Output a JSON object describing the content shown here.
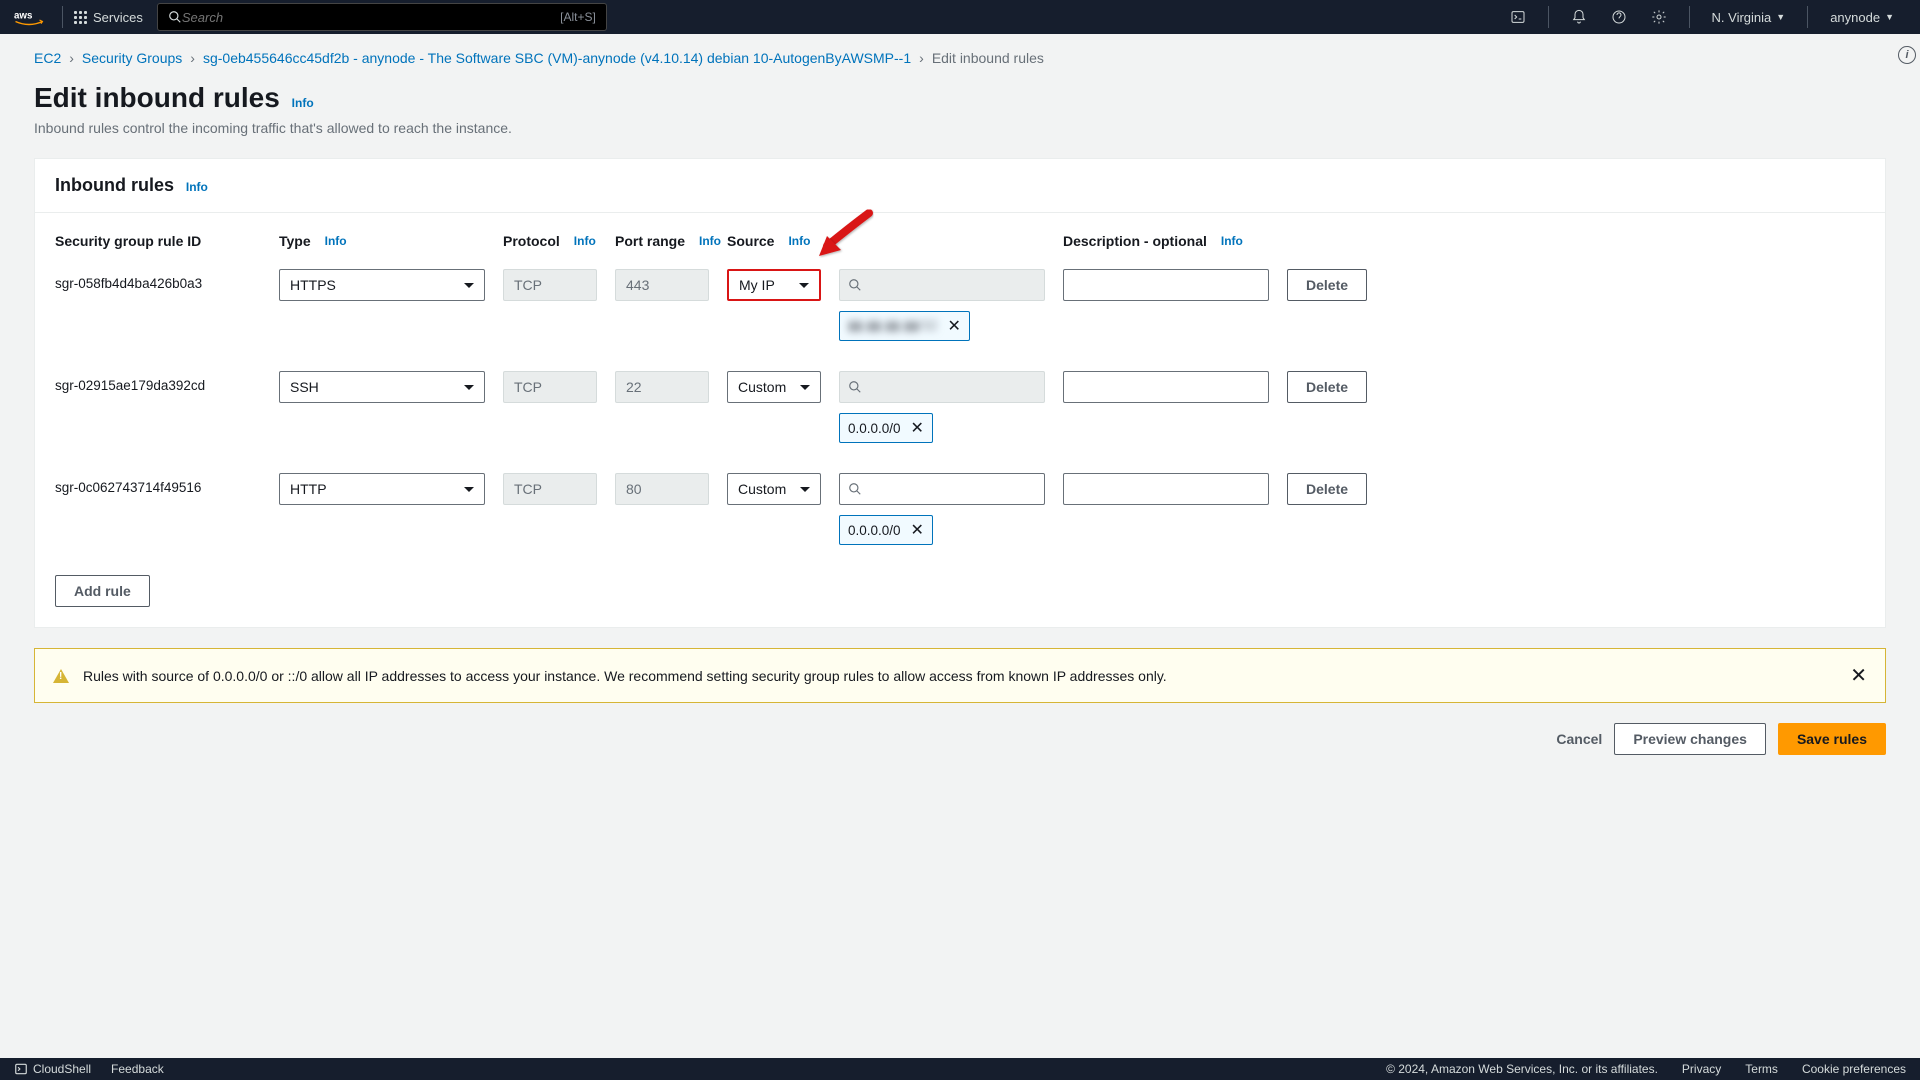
{
  "nav": {
    "services": "Services",
    "search_placeholder": "Search",
    "search_shortcut": "[Alt+S]",
    "region": "N. Virginia",
    "account": "anynode"
  },
  "breadcrumb": {
    "items": [
      "EC2",
      "Security Groups",
      "sg-0eb455646cc45df2b - anynode - The Software SBC (VM)-anynode (v4.10.14) debian 10-AutogenByAWSMP--1"
    ],
    "current": "Edit inbound rules"
  },
  "header": {
    "title": "Edit inbound rules",
    "info": "Info",
    "desc": "Inbound rules control the incoming traffic that's allowed to reach the instance."
  },
  "panel": {
    "title": "Inbound rules",
    "info": "Info"
  },
  "columns": {
    "id": "Security group rule ID",
    "type": "Type",
    "protocol": "Protocol",
    "port_range": "Port range",
    "source": "Source",
    "description": "Description - optional",
    "info": "Info",
    "delete": "Delete"
  },
  "rules": [
    {
      "id": "sgr-058fb4d4ba426b0a3",
      "type": "HTTPS",
      "protocol": "TCP",
      "port": "443",
      "source_type": "My IP",
      "highlighted": true,
      "source_search_disabled": true,
      "chip": "▮▮.▮▮.▮▮.▮▮/32",
      "chip_blurred": true,
      "description": ""
    },
    {
      "id": "sgr-02915ae179da392cd",
      "type": "SSH",
      "protocol": "TCP",
      "port": "22",
      "source_type": "Custom",
      "highlighted": false,
      "source_search_disabled": true,
      "chip": "0.0.0.0/0",
      "chip_blurred": false,
      "description": ""
    },
    {
      "id": "sgr-0c062743714f49516",
      "type": "HTTP",
      "protocol": "TCP",
      "port": "80",
      "source_type": "Custom",
      "highlighted": false,
      "source_search_disabled": false,
      "chip": "0.0.0.0/0",
      "chip_blurred": false,
      "description": ""
    }
  ],
  "add_rule": "Add rule",
  "warning": "Rules with source of 0.0.0.0/0 or ::/0 allow all IP addresses to access your instance. We recommend setting security group rules to allow access from known IP addresses only.",
  "actions": {
    "cancel": "Cancel",
    "preview": "Preview changes",
    "save": "Save rules"
  },
  "footer": {
    "cloudshell": "CloudShell",
    "feedback": "Feedback",
    "copyright": "© 2024, Amazon Web Services, Inc. or its affiliates.",
    "privacy": "Privacy",
    "terms": "Terms",
    "cookies": "Cookie preferences"
  }
}
